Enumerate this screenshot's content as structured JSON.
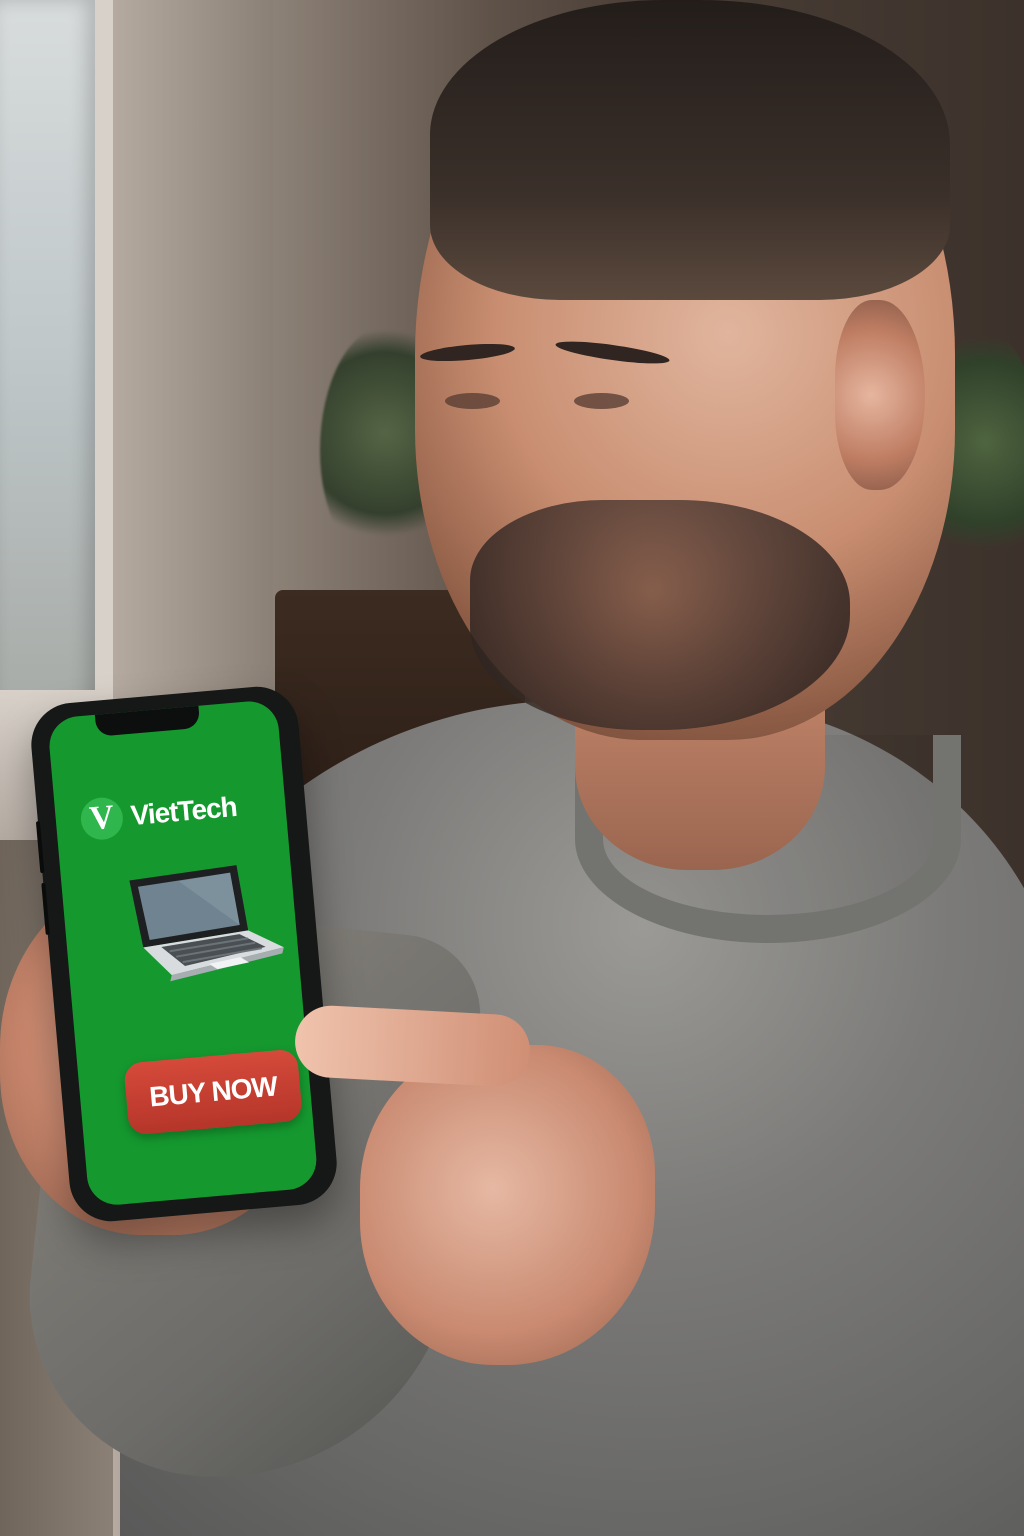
{
  "phone_app": {
    "brand": {
      "logo_letter": "V",
      "name": "VietTech"
    },
    "product_icon": "laptop-icon",
    "cta_label": "BUY NOW",
    "colors": {
      "screen": "#15992f",
      "button": "#c43d31",
      "text": "#ffffff"
    }
  }
}
